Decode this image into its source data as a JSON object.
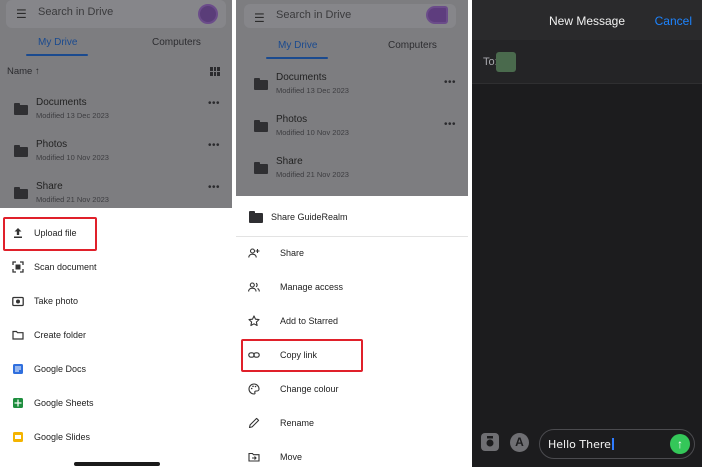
{
  "drive": {
    "search_placeholder": "Search in Drive",
    "tabs": [
      "My Drive",
      "Computers"
    ],
    "sort_label": "Name ↑",
    "files": [
      {
        "name": "Documents",
        "date": "Modified 13 Dec 2023"
      },
      {
        "name": "Photos",
        "date": "Modified 10 Nov 2023"
      },
      {
        "name": "Share",
        "date": "Modified 21 Nov 2023"
      }
    ],
    "more_label": "•••"
  },
  "upload_sheet": {
    "items": [
      {
        "label": "Upload file",
        "icon": "upload-icon"
      },
      {
        "label": "Scan document",
        "icon": "scan-icon"
      },
      {
        "label": "Take photo",
        "icon": "camera-icon"
      },
      {
        "label": "Create folder",
        "icon": "folder-outline-icon"
      },
      {
        "label": "Google Docs",
        "icon": "docs-icon"
      },
      {
        "label": "Google Sheets",
        "icon": "sheets-icon"
      },
      {
        "label": "Google Slides",
        "icon": "slides-icon"
      }
    ],
    "highlighted": "Upload file"
  },
  "share_sheet": {
    "folder_title": "Share GuideRealm",
    "items": [
      {
        "label": "Share",
        "icon": "add-person-icon"
      },
      {
        "label": "Manage access",
        "icon": "people-icon"
      },
      {
        "label": "Add to Starred",
        "icon": "star-icon"
      },
      {
        "label": "Copy link",
        "icon": "link-icon"
      },
      {
        "label": "Change colour",
        "icon": "palette-icon"
      },
      {
        "label": "Rename",
        "icon": "pencil-icon"
      },
      {
        "label": "Move",
        "icon": "move-icon"
      }
    ],
    "highlighted": "Copy link"
  },
  "messages": {
    "title": "New Message",
    "cancel": "Cancel",
    "to_label": "To:",
    "message_text": "Hello There",
    "apps_glyph": "A",
    "send_glyph": "↑"
  },
  "colors": {
    "highlight": "#e0202a",
    "drive_blue": "#1a4a8f",
    "ios_blue": "#1d84ff",
    "send_green": "#34c759"
  }
}
